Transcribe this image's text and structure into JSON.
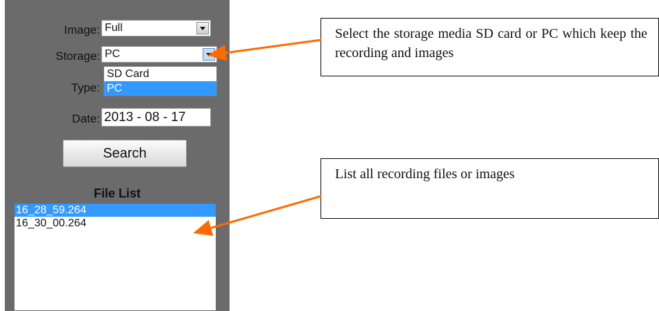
{
  "form": {
    "image_label": "Image:",
    "image_value": "Full",
    "storage_label": "Storage:",
    "storage_value": "PC",
    "storage_options": [
      "SD Card",
      "PC"
    ],
    "storage_selected": "PC",
    "type_label": "Type:",
    "date_label": "Date:",
    "date_value": "2013 - 08 - 17",
    "search_label": "Search"
  },
  "file_list": {
    "title": "File List",
    "items": [
      "16_28_59.264",
      "16_30_00.264"
    ],
    "selected": "16_28_59.264"
  },
  "callouts": {
    "storage_note": "Select the storage media SD card or PC which keep the recording and images",
    "list_note": "List all recording files or images"
  },
  "colors": {
    "panel_bg": "#6b6b6b",
    "selection": "#3399ff",
    "arrow": "#ff6a00"
  }
}
